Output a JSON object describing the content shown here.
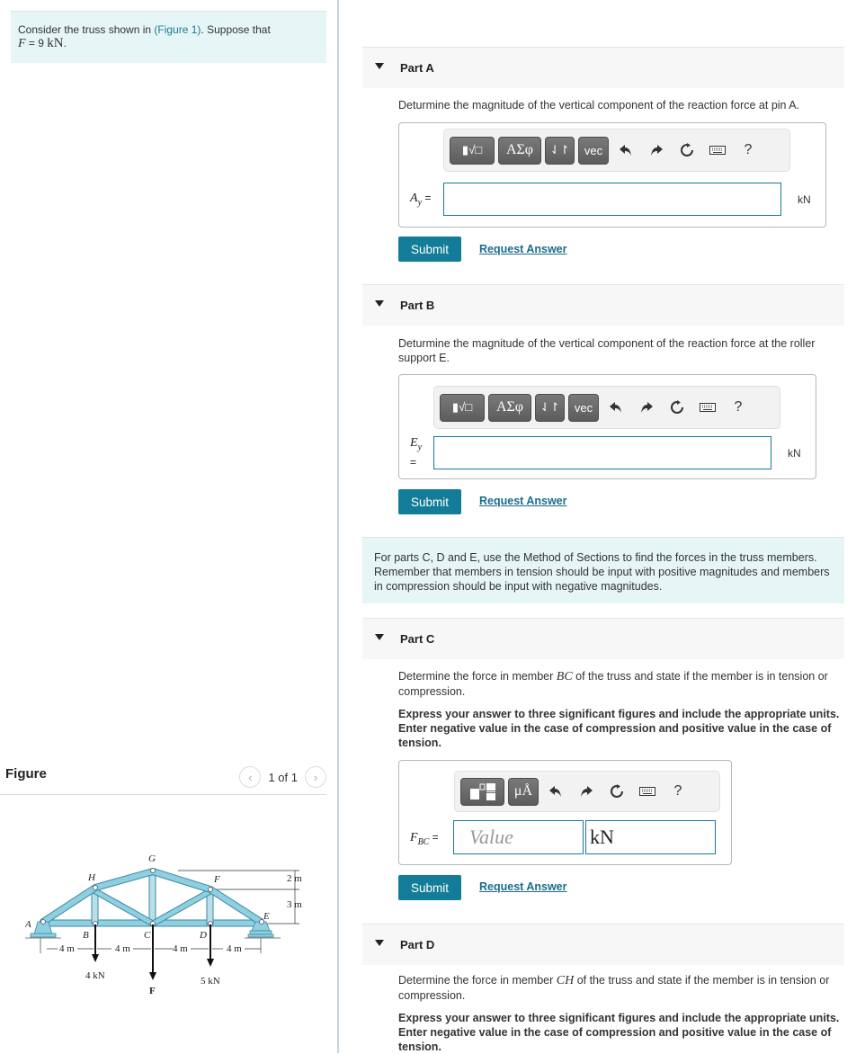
{
  "intro": {
    "text_before": "Consider the truss shown in ",
    "figure_link": "(Figure 1)",
    "text_after": ". Suppose that",
    "var": "F",
    "equals": " = 9 ",
    "unit": "kN",
    "period": "."
  },
  "figure": {
    "title": "Figure",
    "pager": "1 of 1",
    "prev_icon": "‹",
    "next_icon": "›",
    "labels": {
      "A": "A",
      "B": "B",
      "C": "C",
      "D": "D",
      "E": "E",
      "F": "F",
      "G": "G",
      "H": "H"
    },
    "dims": {
      "span1": "4 m",
      "span2": "4 m",
      "span3": "4 m",
      "span4": "4 m",
      "h1": "2 m",
      "h2": "3 m"
    },
    "loads": {
      "B": "4 kN",
      "C": "F",
      "D": "5 kN"
    },
    "colors": {
      "member": "#8ecfe0",
      "member_edge": "#3d8aa3"
    }
  },
  "toolbar": {
    "templates": "▮√□",
    "greek": "ΑΣφ",
    "arrows": "⇃↾",
    "vec": "vec",
    "units": "μÅ",
    "help": "?"
  },
  "parts": {
    "A": {
      "title": "Part A",
      "prompt": "Deturmine the magnitude of the vertical component of the reaction force at pin A.",
      "label_var": "A",
      "label_sub": "y",
      "label_eq": " =",
      "unit": "kN",
      "value": ""
    },
    "B": {
      "title": "Part B",
      "prompt": "Deturmine the magnitude of the vertical component of the reaction force at the roller support E.",
      "label_var": "E",
      "label_sub": "y",
      "label_eq": "=",
      "unit": "kN",
      "value": ""
    },
    "note": "For parts C, D and E, use the Method of Sections to find the forces in the truss members. Remember that members in tension should be input with positive magnitudes and members in compression should be input with negative magnitudes.",
    "C": {
      "title": "Part C",
      "prompt_before": "Determine the force in member ",
      "member": "BC",
      "prompt_after": " of the truss and state if the member is in tension or compression.",
      "instructions": "Express your answer to three significant figures and include the appropriate units. Enter negative value in the case of compression and positive value in the case of tension.",
      "label_var": "F",
      "label_sub": "BC",
      "label_eq": " =",
      "value_placeholder": "Value",
      "unit_value": "kN"
    },
    "D": {
      "title": "Part D",
      "prompt_before": "Determine the force in member ",
      "member": "CH",
      "prompt_after": " of the truss and state if the member is in tension or compression.",
      "instructions": "Express your answer to three significant figures and include the appropriate units. Enter negative value in the case of compression and positive value in the case of tension."
    }
  },
  "buttons": {
    "submit": "Submit",
    "request_answer": "Request Answer"
  }
}
